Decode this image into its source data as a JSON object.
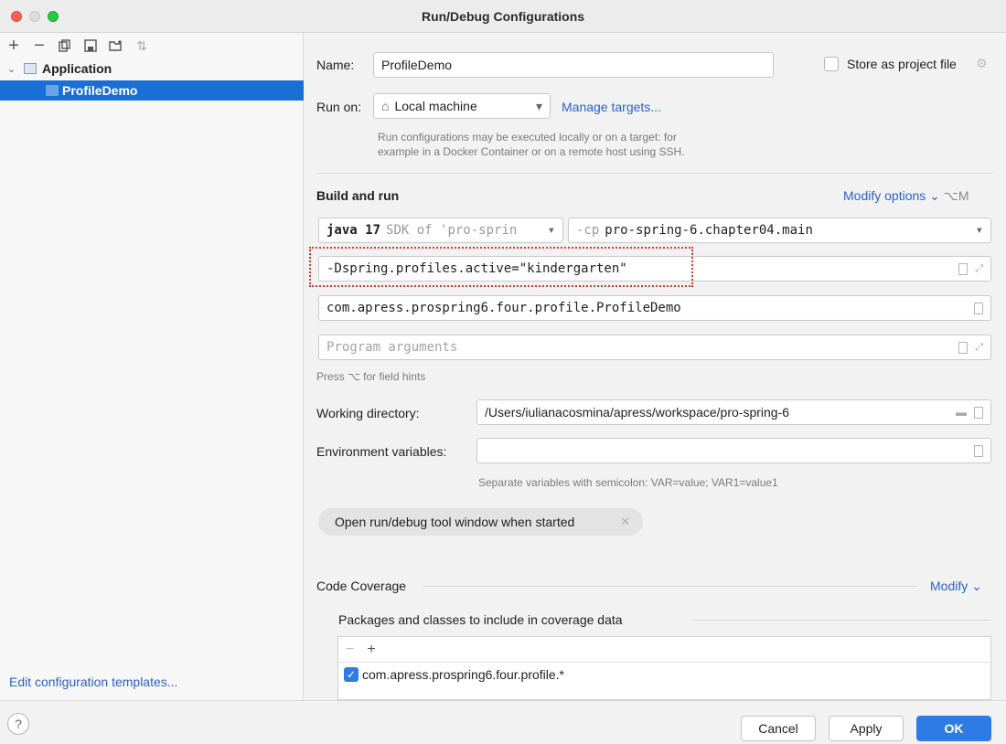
{
  "window": {
    "title": "Run/Debug Configurations"
  },
  "sidebar": {
    "toolbar": [
      {
        "name": "add-icon",
        "glyph": "+"
      },
      {
        "name": "remove-icon",
        "glyph": "−"
      },
      {
        "name": "copy-icon",
        "glyph": "⧉"
      },
      {
        "name": "save-icon",
        "glyph": "▤"
      },
      {
        "name": "move-into-folder-icon",
        "glyph": "▦"
      },
      {
        "name": "sort-icon",
        "glyph": "⇅"
      }
    ],
    "tree": {
      "group_label": "Application",
      "selected_item": "ProfileDemo"
    },
    "edit_templates_link": "Edit configuration templates..."
  },
  "form": {
    "name_label": "Name:",
    "name_value": "ProfileDemo",
    "store_label": "Store as project file",
    "run_on_label": "Run on:",
    "run_on_value": "Local machine",
    "manage_targets": "Manage targets...",
    "run_on_hint_1": "Run configurations may be executed locally or on a target: for",
    "run_on_hint_2": "example in a Docker Container or on a remote host using SSH.",
    "build_run_title": "Build and run",
    "modify_options": "Modify options",
    "modify_shortcut": "⌥M",
    "jdk_bold": "java 17",
    "jdk_rest": "SDK of 'pro-sprin",
    "cp_prefix": "-cp",
    "cp_value": "pro-spring-6.chapter04.main",
    "vm_options": "-Dspring.profiles.active=\"kindergarten\"",
    "main_class": "com.apress.prospring6.four.profile.ProfileDemo",
    "program_args_placeholder": "Program arguments",
    "field_hint": "Press ⌥ for field hints",
    "working_dir_label": "Working directory:",
    "working_dir_value": "/Users/iulianacosmina/apress/workspace/pro-spring-6",
    "env_label": "Environment variables:",
    "env_value": "",
    "env_hint": "Separate variables with semicolon: VAR=value; VAR1=value1",
    "open_tool_window_chip": "Open run/debug tool window when started",
    "code_coverage_title": "Code Coverage",
    "coverage_modify": "Modify",
    "packages_title": "Packages and classes to include in coverage data",
    "coverage_items": [
      "com.apress.prospring6.four.profile.*"
    ]
  },
  "footer": {
    "help": "?",
    "cancel": "Cancel",
    "apply": "Apply",
    "ok": "OK"
  },
  "colors": {
    "accent": "#2f7be5",
    "selection": "#1a6fd6",
    "link": "#2a63c8",
    "highlight_border": "#d9372c"
  }
}
